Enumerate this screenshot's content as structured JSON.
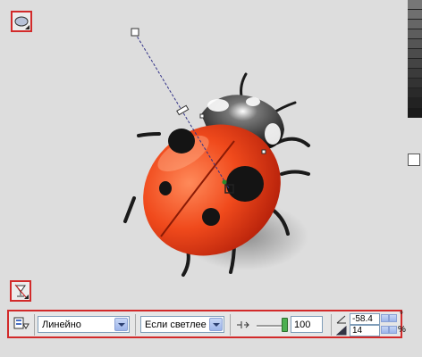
{
  "tools": {
    "top_tool_icon": "ellipse-icon",
    "bottom_tool_icon": "transparency-icon"
  },
  "toolbar": {
    "mode_select": "Линейно",
    "apply_select": "Если светлее",
    "opacity_value": "100",
    "opacity_fraction": 1.0,
    "angle_value": "-58.4",
    "angle_unit": "°",
    "edge_value": "14",
    "edge_unit": "%"
  },
  "swatches": [
    "#777777",
    "#6f6f6f",
    "#666666",
    "#5d5d5d",
    "#555555",
    "#4c4c4c",
    "#444444",
    "#3b3b3b",
    "#333333",
    "#2a2a2a",
    "#222222",
    "#1a1a1a"
  ]
}
